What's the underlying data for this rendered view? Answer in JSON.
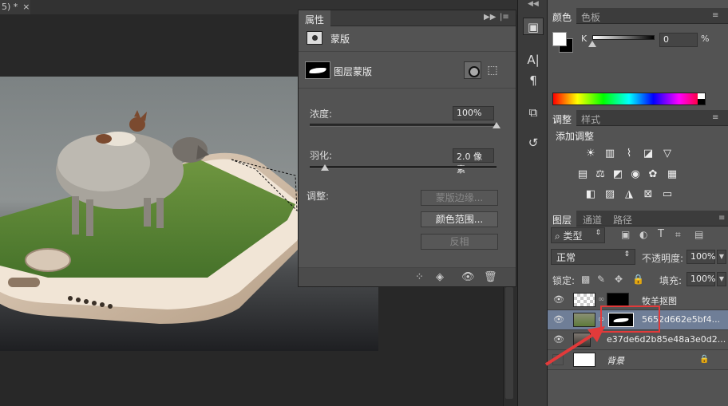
{
  "document": {
    "tab_title": "5) *",
    "tab_close": "×"
  },
  "properties": {
    "tab_label": "属性",
    "header_menu": "▸▸ | ≡",
    "section_title": "蒙版",
    "mask_type_label": "图层蒙版",
    "density_label": "浓度:",
    "density_value": "100%",
    "density_level": 1.0,
    "feather_label": "羽化:",
    "feather_value": "2.0 像素",
    "feather_level": 0.08,
    "refine_label": "调整:",
    "mask_edge_button": "蒙版边缘...",
    "color_range_button": "颜色范围...",
    "invert_button": "反相"
  },
  "color_panel": {
    "tabs": [
      "颜色",
      "色板"
    ],
    "k_label": "K",
    "k_value": "0",
    "k_unit": "%",
    "k_level": 0.0
  },
  "adjustments_panel": {
    "tabs": [
      "调整",
      "样式"
    ],
    "title": "添加调整",
    "row1_icons": [
      "brightness-icon",
      "levels-icon",
      "curves-icon",
      "exposure-icon",
      "vibrance-icon"
    ],
    "row2_icons": [
      "hue-saturation-icon",
      "color-balance-icon",
      "black-white-icon",
      "photo-filter-icon",
      "channel-mixer-icon",
      "color-lookup-icon"
    ],
    "row3_icons": [
      "invert-icon",
      "posterize-icon",
      "threshold-icon",
      "selective-color-icon",
      "gradient-map-icon"
    ]
  },
  "layers_panel": {
    "tabs": [
      "图层",
      "通道",
      "路径"
    ],
    "filter_kind": "类型",
    "blend_mode": "正常",
    "opacity_label": "不透明度:",
    "opacity_value": "100%",
    "lock_label": "锁定:",
    "fill_label": "填充:",
    "fill_value": "100%",
    "layers": [
      {
        "name": "牧羊抠图",
        "selected": false
      },
      {
        "name": "5652d662e5bf4...",
        "selected": true
      },
      {
        "name": "e37de6d2b85e48a3e0d2...",
        "selected": false
      },
      {
        "name": "背景",
        "selected": false
      }
    ]
  },
  "colors": {
    "panel_bg": "#535353",
    "selection_blue": "#6f7e97",
    "highlight_red": "#e23a3a"
  }
}
